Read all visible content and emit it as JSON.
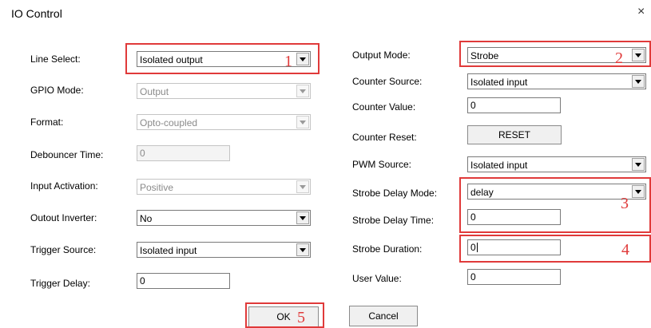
{
  "window": {
    "title": "IO Control",
    "close_glyph": "×"
  },
  "left": {
    "line_select": {
      "label": "Line Select:",
      "value": "Isolated output"
    },
    "gpio_mode": {
      "label": "GPIO Mode:",
      "value": "Output"
    },
    "format": {
      "label": "Format:",
      "value": "Opto-coupled"
    },
    "debouncer_time": {
      "label": "Debouncer Time:",
      "value": "0"
    },
    "input_activation": {
      "label": "Input Activation:",
      "value": "Positive"
    },
    "output_inverter": {
      "label": "Outout Inverter:",
      "value": "No"
    },
    "trigger_source": {
      "label": "Trigger Source:",
      "value": "Isolated input"
    },
    "trigger_delay": {
      "label": "Trigger Delay:",
      "value": "0"
    }
  },
  "right": {
    "output_mode": {
      "label": "Output Mode:",
      "value": "Strobe"
    },
    "counter_source": {
      "label": "Counter Source:",
      "value": "Isolated input"
    },
    "counter_value": {
      "label": "Counter Value:",
      "value": "0"
    },
    "counter_reset": {
      "label": "Counter Reset:",
      "button": "RESET"
    },
    "pwm_source": {
      "label": "PWM Source:",
      "value": "Isolated input"
    },
    "strobe_delay_mode": {
      "label": "Strobe Delay Mode:",
      "value": "delay"
    },
    "strobe_delay_time": {
      "label": "Strobe Delay Time:",
      "value": "0"
    },
    "strobe_duration": {
      "label": "Strobe Duration:",
      "value": "0"
    },
    "user_value": {
      "label": "User Value:",
      "value": "0"
    }
  },
  "buttons": {
    "ok": "OK",
    "cancel": "Cancel"
  },
  "annotations": {
    "color": "#e03a3a",
    "labels": [
      "1",
      "2",
      "3",
      "4",
      "5"
    ]
  }
}
